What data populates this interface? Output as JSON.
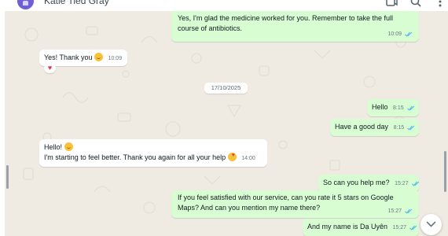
{
  "header": {
    "contact_name": "Katie Tied Gray",
    "icons": [
      "new-chat-icon",
      "search-icon",
      "menu-icon"
    ]
  },
  "colors": {
    "outgoing_bubble": "#d9fdd3",
    "incoming_bubble": "#ffffff",
    "chat_background": "#efeae2",
    "read_ticks": "#53bdeb",
    "avatar": "#6f5fd6",
    "reaction": "#e8334a"
  },
  "messages": [
    {
      "direction": "outgoing",
      "text": "Yes, I'm glad the medicine worked for you. Remember to take the full course of antibiotics.",
      "time": "10:09",
      "status": "read"
    },
    {
      "direction": "incoming",
      "text": "Yes! Thank you",
      "emoji": "smiling-face-icon",
      "time": "10:09",
      "reaction": "♥"
    },
    {
      "direction": "outgoing",
      "text": "Hello",
      "time": "8:15",
      "status": "read"
    },
    {
      "direction": "outgoing",
      "text": "Have a good day",
      "time": "8:15",
      "status": "read"
    },
    {
      "direction": "incoming",
      "line1": "Hello!",
      "line2": "I'm starting to feel better. Thank you again for all your help",
      "emoji": "smiling-face-with-hearts-icon",
      "time": "14:00"
    },
    {
      "direction": "outgoing",
      "text": "So can you help me?",
      "time": "15:27",
      "status": "read"
    },
    {
      "direction": "outgoing",
      "text": "If you feel satisfied with our service, can you rate it 5 stars on Google Maps? And can you mention my name there?",
      "time": "15:27",
      "status": "read"
    },
    {
      "direction": "outgoing",
      "text": "And my name is Dạ Uyên",
      "time": "15:27",
      "status": "read"
    }
  ],
  "date_separator": "17/10/2025"
}
